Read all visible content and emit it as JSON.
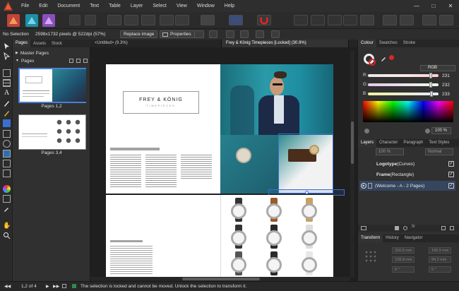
{
  "menubar": {
    "items": [
      "File",
      "Edit",
      "Document",
      "Text",
      "Table",
      "Layer",
      "Select",
      "View",
      "Window",
      "Help"
    ],
    "minimize_glyph": "—",
    "maximize_glyph": "□",
    "close_glyph": "✕"
  },
  "context": {
    "selection": "No Selection",
    "image_info": "2598x1732 pixels @ 522dpi (57%)",
    "replace_image": "Replace image",
    "properties": "Properties"
  },
  "pages_panel": {
    "tabs": [
      "Pages",
      "Assets",
      "Stock"
    ],
    "master_pages": "Master Pages",
    "pages_label": "Pages",
    "spreads": [
      "Pages 1,2",
      "Pages 3,4"
    ]
  },
  "document_tabs": [
    "<Untitled> (9.3%)",
    "Frey & König Timepieces [Locked] (30.9%)"
  ],
  "document": {
    "logo_text": "FREY & KÖNIG",
    "logo_sub": "TIMEPIECES"
  },
  "colour_panel": {
    "tabs": [
      "Colour",
      "Swatches",
      "Stroke"
    ],
    "model": "RGB",
    "r_label": "R:",
    "g_label": "G:",
    "b_label": "B:",
    "r": 231,
    "g": 232,
    "b": 233,
    "r_level": 0.906,
    "g_level": 0.91,
    "b_level": 0.914,
    "opacity": "100 %",
    "icons": [
      "eyedropper-icon",
      "colour-wheel-icon"
    ]
  },
  "layers_panel": {
    "tabs": [
      "Layers",
      "Character",
      "Paragraph",
      "Text Styles"
    ],
    "opacity": "100 %",
    "blend_mode": "Normal",
    "layers": [
      {
        "name": "Logotype",
        "type": " (Curves)"
      },
      {
        "name": "Frame",
        "type": " (Rectangle)"
      },
      {
        "name": "(Welcome - A - 2 Pages)",
        "type": ""
      }
    ]
  },
  "transform_panel": {
    "tabs": [
      "Transform",
      "History",
      "Navigator"
    ],
    "x": "316.5 mm",
    "y": "128.8 mm",
    "w": "106.5 mm",
    "h": "84.2 mm",
    "r": "0 °",
    "s": "0 °"
  },
  "status": {
    "page": "1,2 of 4",
    "message": "The selection is locked and cannot be moved. Unlock the selection to transform it."
  },
  "colors": {
    "accent": "#3a6fd1",
    "red": "#e02424"
  }
}
